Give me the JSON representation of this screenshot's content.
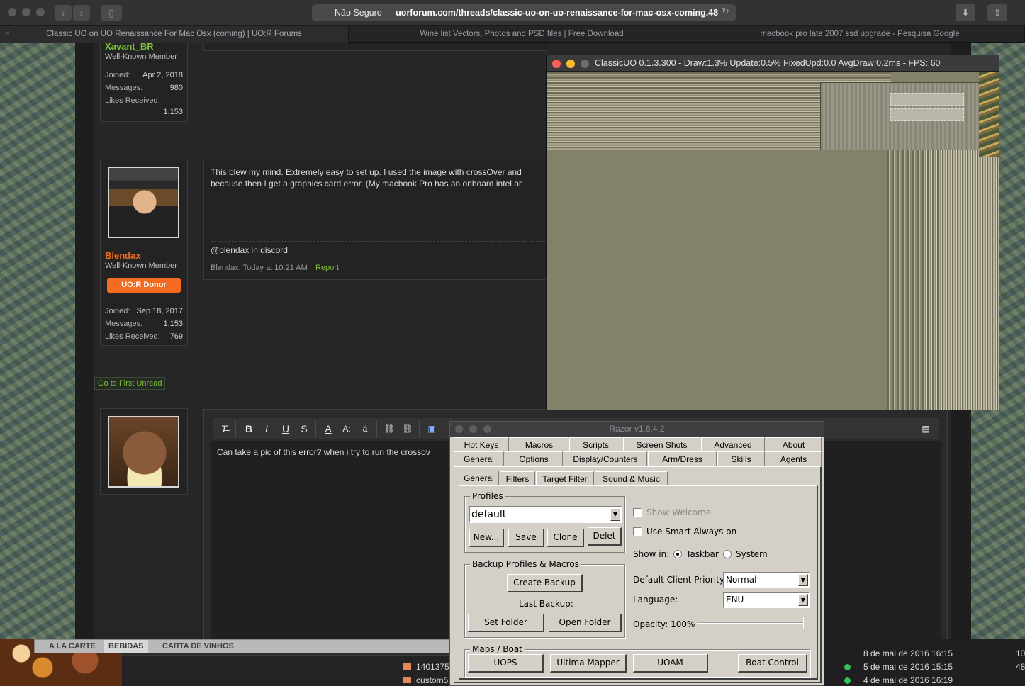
{
  "browser": {
    "address_prefix": "Não Seguro — ",
    "address_url": "uorforum.com/threads/classic-uo-on-uo-renaissance-for-mac-osx-coming.48",
    "tabs": [
      {
        "label": "Classic UO on UO Renaissance For Mac Osx (coming) | UO:R Forums"
      },
      {
        "label": "Wine list Vectors, Photos and PSD files | Free Download"
      },
      {
        "label": "macbook pro late 2007 ssd upgrade - Pesquisa Google"
      }
    ]
  },
  "forum": {
    "post1": {
      "username": "Xavant_BR",
      "title": "Well-Known Member",
      "stats": [
        {
          "label": "Joined:",
          "value": "Apr 2, 2018"
        },
        {
          "label": "Messages:",
          "value": "980"
        },
        {
          "label": "Likes Received:",
          "value": "1,153"
        }
      ]
    },
    "post2": {
      "username": "Blendax",
      "title": "Well-Known Member",
      "badge": "UO:R Donor",
      "stats": [
        {
          "label": "Joined:",
          "value": "Sep 18, 2017"
        },
        {
          "label": "Messages:",
          "value": "1,153"
        },
        {
          "label": "Likes Received:",
          "value": "769"
        }
      ],
      "body_line1": "This blew my mind. Extremely easy to set up. I used the image with crossOver and",
      "body_line2": "because then I get a graphics card error. (My macbook Pro has an onboard intel ar",
      "signature": "@blendax in discord",
      "meta": "Blendax, Today at 10:21 AM",
      "report": "Report"
    },
    "go_first_unread": "Go to First Unread",
    "reply_text": "Can take a pic of this error? when i try to run the crossov"
  },
  "bottom": {
    "menu_tabs": [
      "A LA CARTE",
      "BEBIDAS",
      "CARTA DE VINHOS"
    ],
    "files": [
      "1401375",
      "custom5"
    ],
    "dates": [
      "8 de mai de 2016 16:15",
      "5 de mai de 2016 15:15",
      "4 de mai de 2016 16:19"
    ],
    "sizes": [
      "10",
      "48"
    ]
  },
  "classicuo": {
    "title": "ClassicUO 0.1.3.300 - Draw:1.3% Update:0.5% FixedUpd:0.0 AvgDraw:0.2ms  - FPS: 60"
  },
  "razor": {
    "title": "Razor v1.6.4.2",
    "tabs_row1": [
      "Hot Keys",
      "Macros",
      "Scripts",
      "Screen Shots",
      "Advanced",
      "About"
    ],
    "tabs_row2": [
      "General",
      "Options",
      "Display/Counters",
      "Arm/Dress",
      "Skills",
      "Agents"
    ],
    "subtabs": [
      "General",
      "Filters",
      "Target Filter",
      "Sound & Music"
    ],
    "profiles_legend": "Profiles",
    "profile_value": "default",
    "btn_new": "New...",
    "btn_save": "Save",
    "btn_clone": "Clone",
    "btn_delete": "Delet",
    "backup_legend": "Backup Profiles & Macros",
    "btn_create_backup": "Create Backup",
    "last_backup": "Last Backup:",
    "btn_set_folder": "Set Folder",
    "btn_open_folder": "Open Folder",
    "show_welcome": "Show Welcome",
    "smart_always_on": "Use Smart Always on",
    "show_in": "Show in:",
    "radio_taskbar": "Taskbar",
    "radio_system": "System",
    "priority_label": "Default Client Priority:",
    "priority_value": "Normal",
    "language_label": "Language:",
    "language_value": "ENU",
    "opacity_label": "Opacity: 100%",
    "opacity_level": 1.0,
    "maps_legend": "Maps / Boat",
    "btn_uops": "UOPS",
    "btn_ultima_mapper": "Ultima Mapper",
    "btn_uoam": "UOAM",
    "btn_boat_control": "Boat Control"
  }
}
